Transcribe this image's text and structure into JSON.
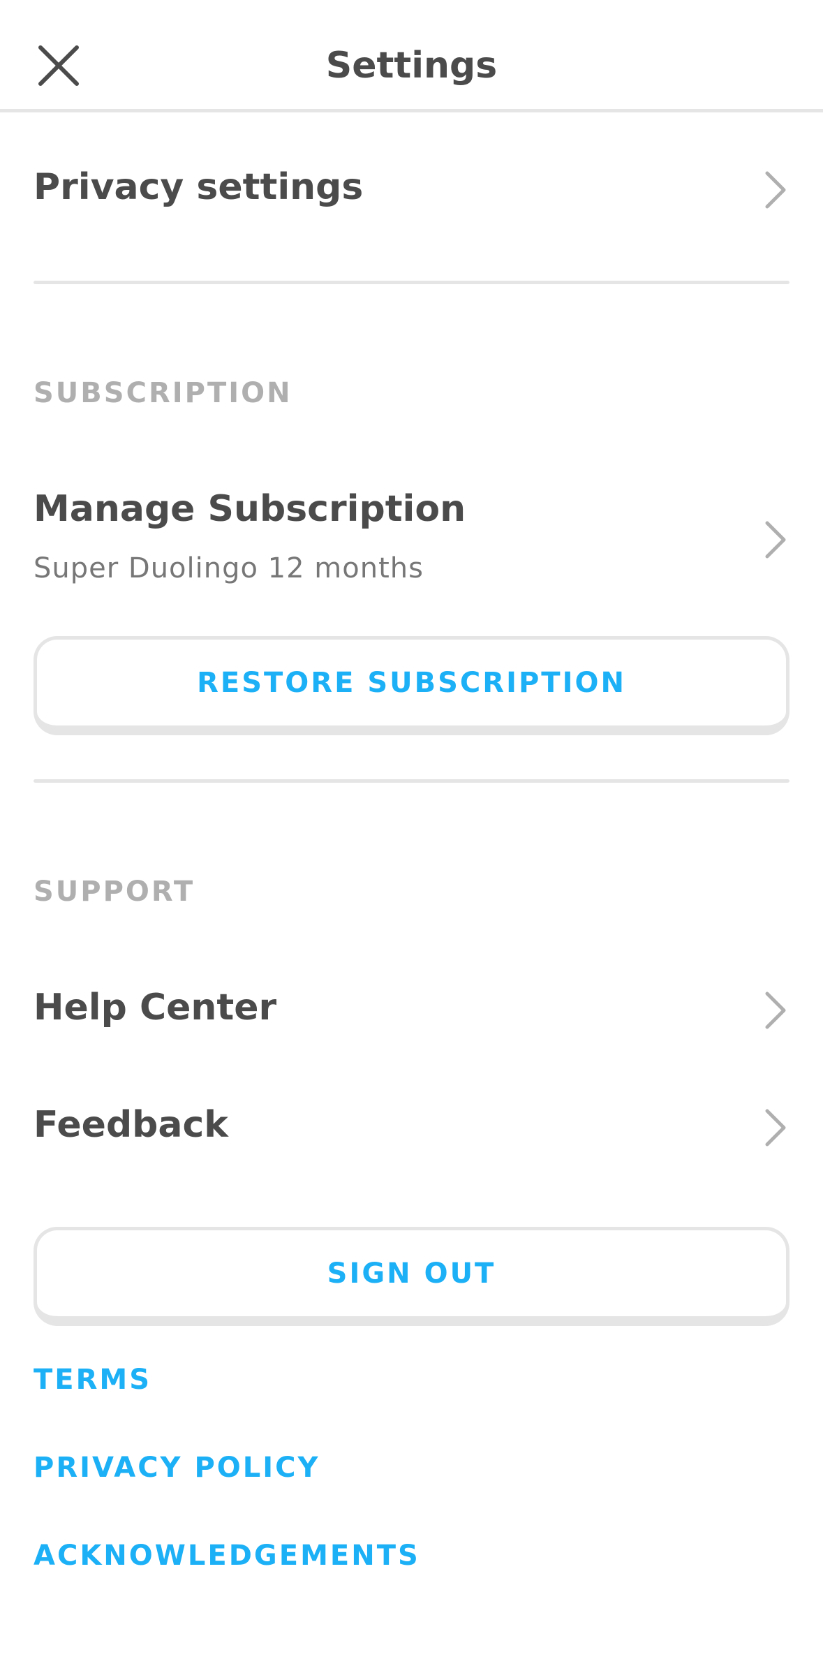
{
  "header": {
    "title": "Settings",
    "close_icon": "close-icon"
  },
  "privacy": {
    "title": "Privacy settings"
  },
  "subscription": {
    "section_label": "SUBSCRIPTION",
    "manage_title": "Manage Subscription",
    "manage_subtitle": "Super Duolingo 12 months",
    "restore_label": "RESTORE SUBSCRIPTION"
  },
  "support": {
    "section_label": "SUPPORT",
    "items": [
      {
        "label": "Help Center"
      },
      {
        "label": "Feedback"
      }
    ]
  },
  "account": {
    "sign_out_label": "SIGN OUT"
  },
  "links": {
    "terms": "TERMS",
    "privacy_policy": "PRIVACY POLICY",
    "acknowledgements": "ACKNOWLEDGEMENTS"
  },
  "colors": {
    "accent": "#1cb0f6",
    "text": "#4b4b4b",
    "muted": "#afafaf",
    "border": "#e5e5e5"
  }
}
